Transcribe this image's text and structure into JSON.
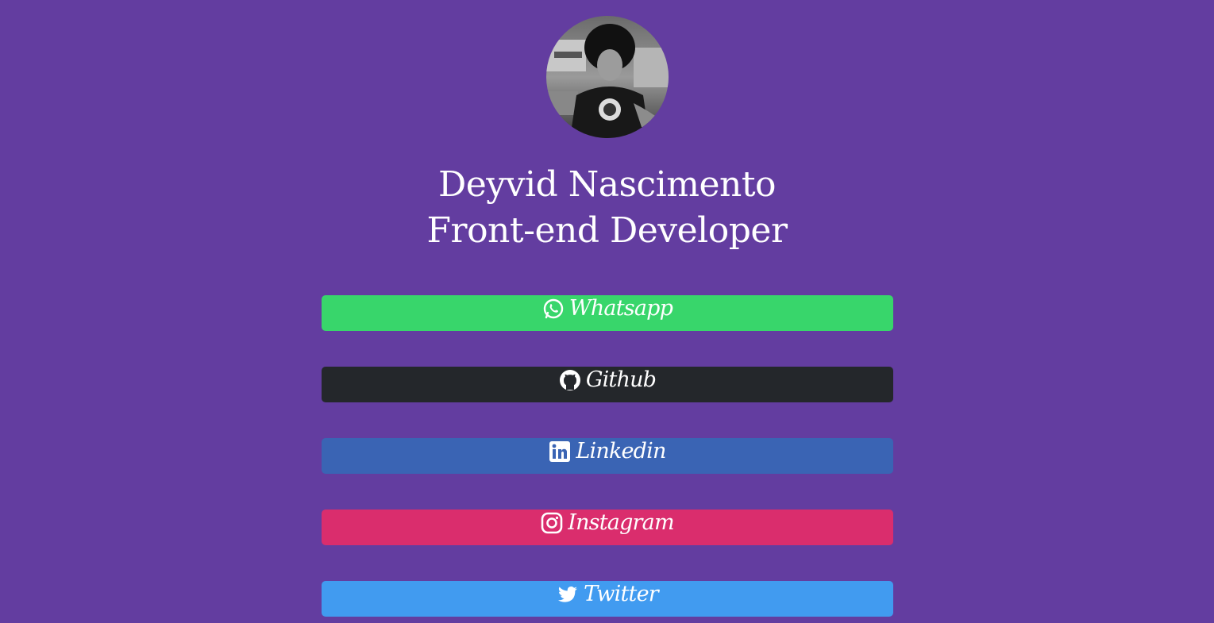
{
  "profile": {
    "name": "Deyvid Nascimento",
    "role": "Front-end Developer"
  },
  "links": [
    {
      "label": "Whatsapp",
      "icon": "whatsapp-icon",
      "color": "#38d66b"
    },
    {
      "label": "Github",
      "icon": "github-icon",
      "color": "#24272b"
    },
    {
      "label": "Linkedin",
      "icon": "linkedin-icon",
      "color": "#3a64b4"
    },
    {
      "label": "Instagram",
      "icon": "instagram-icon",
      "color": "#da2d6d"
    },
    {
      "label": "Twitter",
      "icon": "twitter-icon",
      "color": "#419bf0"
    }
  ],
  "colors": {
    "background": "#633da0",
    "text": "#ffffff"
  }
}
